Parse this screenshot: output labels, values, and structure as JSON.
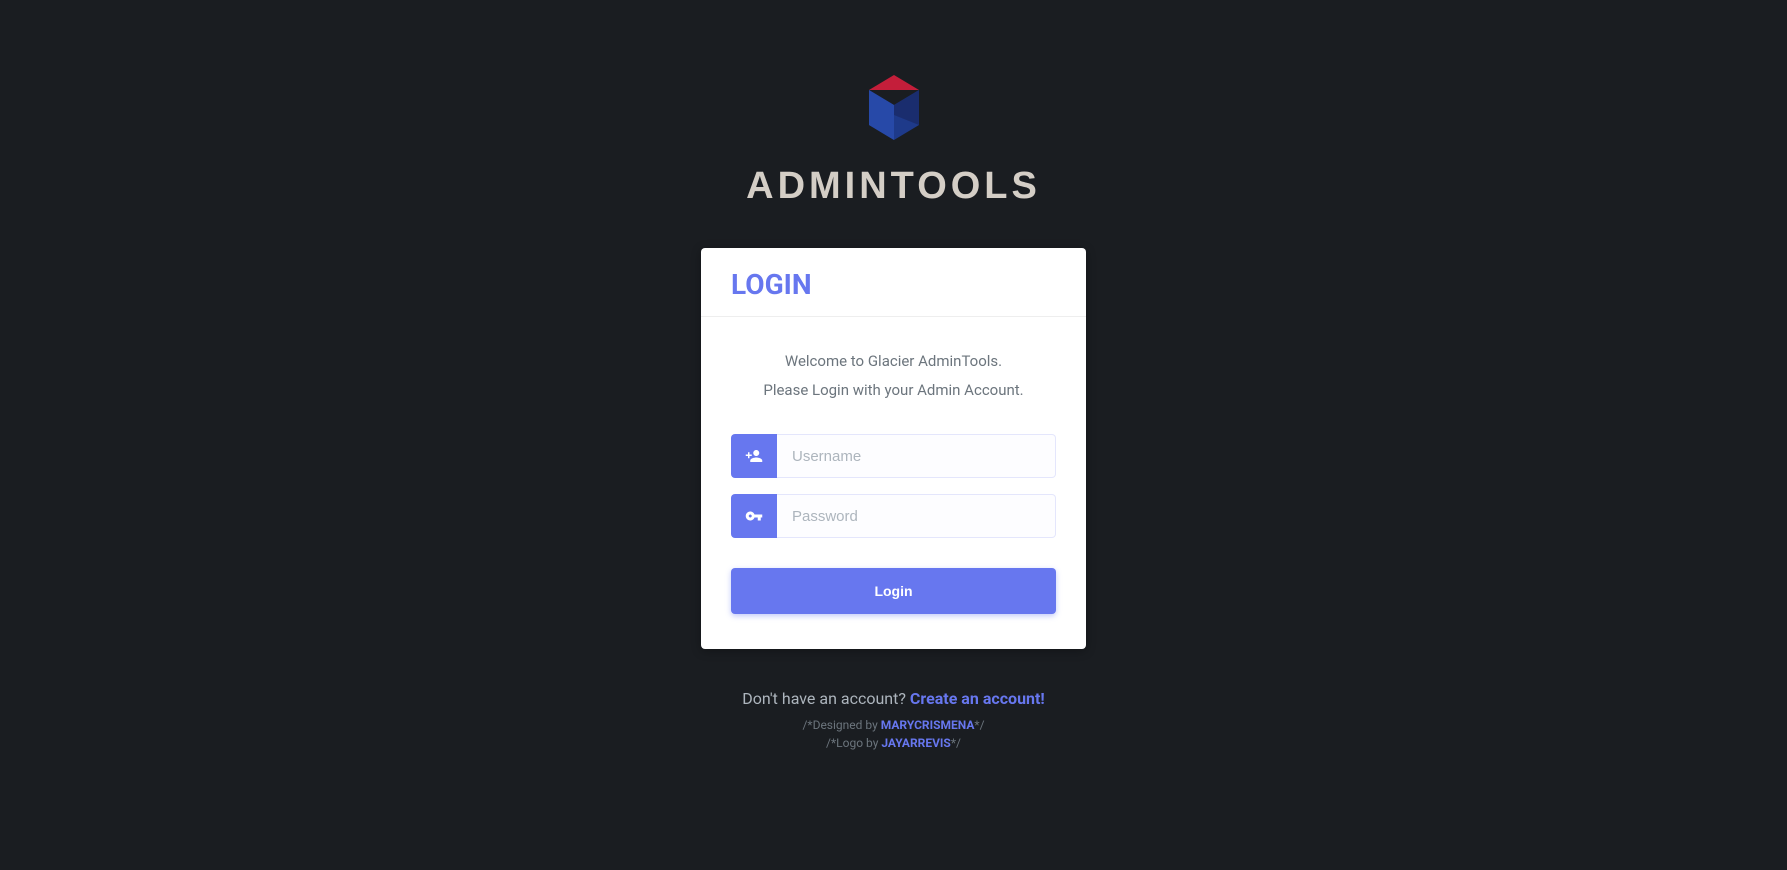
{
  "header": {
    "app_title": "ADMINTOOLS"
  },
  "login": {
    "title": "LOGIN",
    "welcome_line1": "Welcome to Glacier AdminTools.",
    "welcome_line2": "Please Login with your Admin Account.",
    "username_placeholder": "Username",
    "password_placeholder": "Password",
    "button_label": "Login"
  },
  "footer": {
    "signup_prompt": "Don't have an account? ",
    "signup_link": "Create an account!",
    "designed_prefix": "/*Designed by ",
    "designed_name": "MARYCRISMENA",
    "designed_suffix": "*/",
    "logo_prefix": "/*Logo by ",
    "logo_name": "JAYARREVIS",
    "logo_suffix": "*/"
  }
}
